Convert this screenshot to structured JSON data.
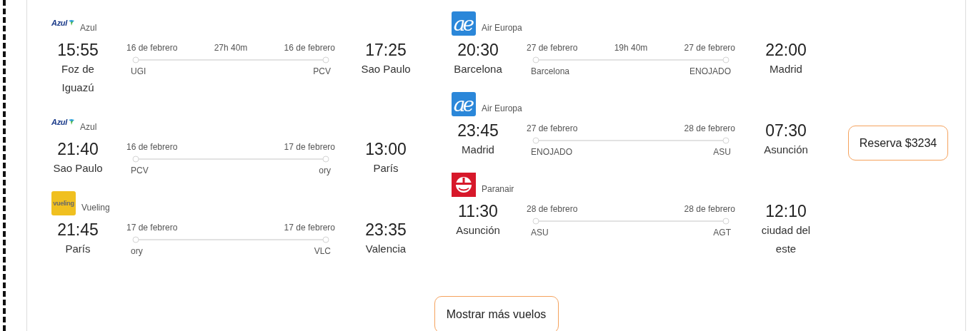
{
  "outbound": {
    "segments": [
      {
        "airline": {
          "kind": "azul",
          "logo_text": "Azul",
          "name": "Azul"
        },
        "departure": {
          "time": "15:55",
          "city": "Foz de Iguazú",
          "date": "16 de febrero",
          "code": "UGI"
        },
        "duration": "27h 40m",
        "arrival": {
          "time": "17:25",
          "city": "Sao Paulo",
          "date": "16 de febrero",
          "code": "PCV"
        }
      },
      {
        "airline": {
          "kind": "azul",
          "logo_text": "Azul",
          "name": "Azul"
        },
        "departure": {
          "time": "21:40",
          "city": "Sao Paulo",
          "date": "16 de febrero",
          "code": "PCV"
        },
        "arrival": {
          "time": "13:00",
          "city": "París",
          "date": "17 de febrero",
          "code": "ory"
        }
      },
      {
        "airline": {
          "kind": "vueling",
          "logo_text": "vueling",
          "name": "Vueling"
        },
        "departure": {
          "time": "21:45",
          "city": "París",
          "date": "17 de febrero",
          "code": "ory"
        },
        "arrival": {
          "time": "23:35",
          "city": "Valencia",
          "date": "17 de febrero",
          "code": "VLC"
        }
      }
    ]
  },
  "return": {
    "segments": [
      {
        "airline": {
          "kind": "air-europa",
          "logo_text": "ae",
          "name": "Air Europa"
        },
        "departure": {
          "time": "20:30",
          "city": "Barcelona",
          "date": "27 de febrero",
          "code": "Barcelona"
        },
        "duration": "19h 40m",
        "arrival": {
          "time": "22:00",
          "city": "Madrid",
          "date": "27 de febrero",
          "code": "ENOJADO"
        }
      },
      {
        "airline": {
          "kind": "air-europa",
          "logo_text": "ae",
          "name": "Air Europa"
        },
        "departure": {
          "time": "23:45",
          "city": "Madrid",
          "date": "27 de febrero",
          "code": "ENOJADO"
        },
        "arrival": {
          "time": "07:30",
          "city": "Asunción",
          "date": "28 de febrero",
          "code": "ASU"
        }
      },
      {
        "airline": {
          "kind": "paranair",
          "name": "Paranair"
        },
        "departure": {
          "time": "11:30",
          "city": "Asunción",
          "date": "28 de febrero",
          "code": "ASU"
        },
        "arrival": {
          "time": "12:10",
          "city": "ciudad del este",
          "date": "28 de febrero",
          "code": "AGT"
        }
      }
    ]
  },
  "book_button": "Reserva $3234",
  "more_button": "Mostrar más vuelos"
}
